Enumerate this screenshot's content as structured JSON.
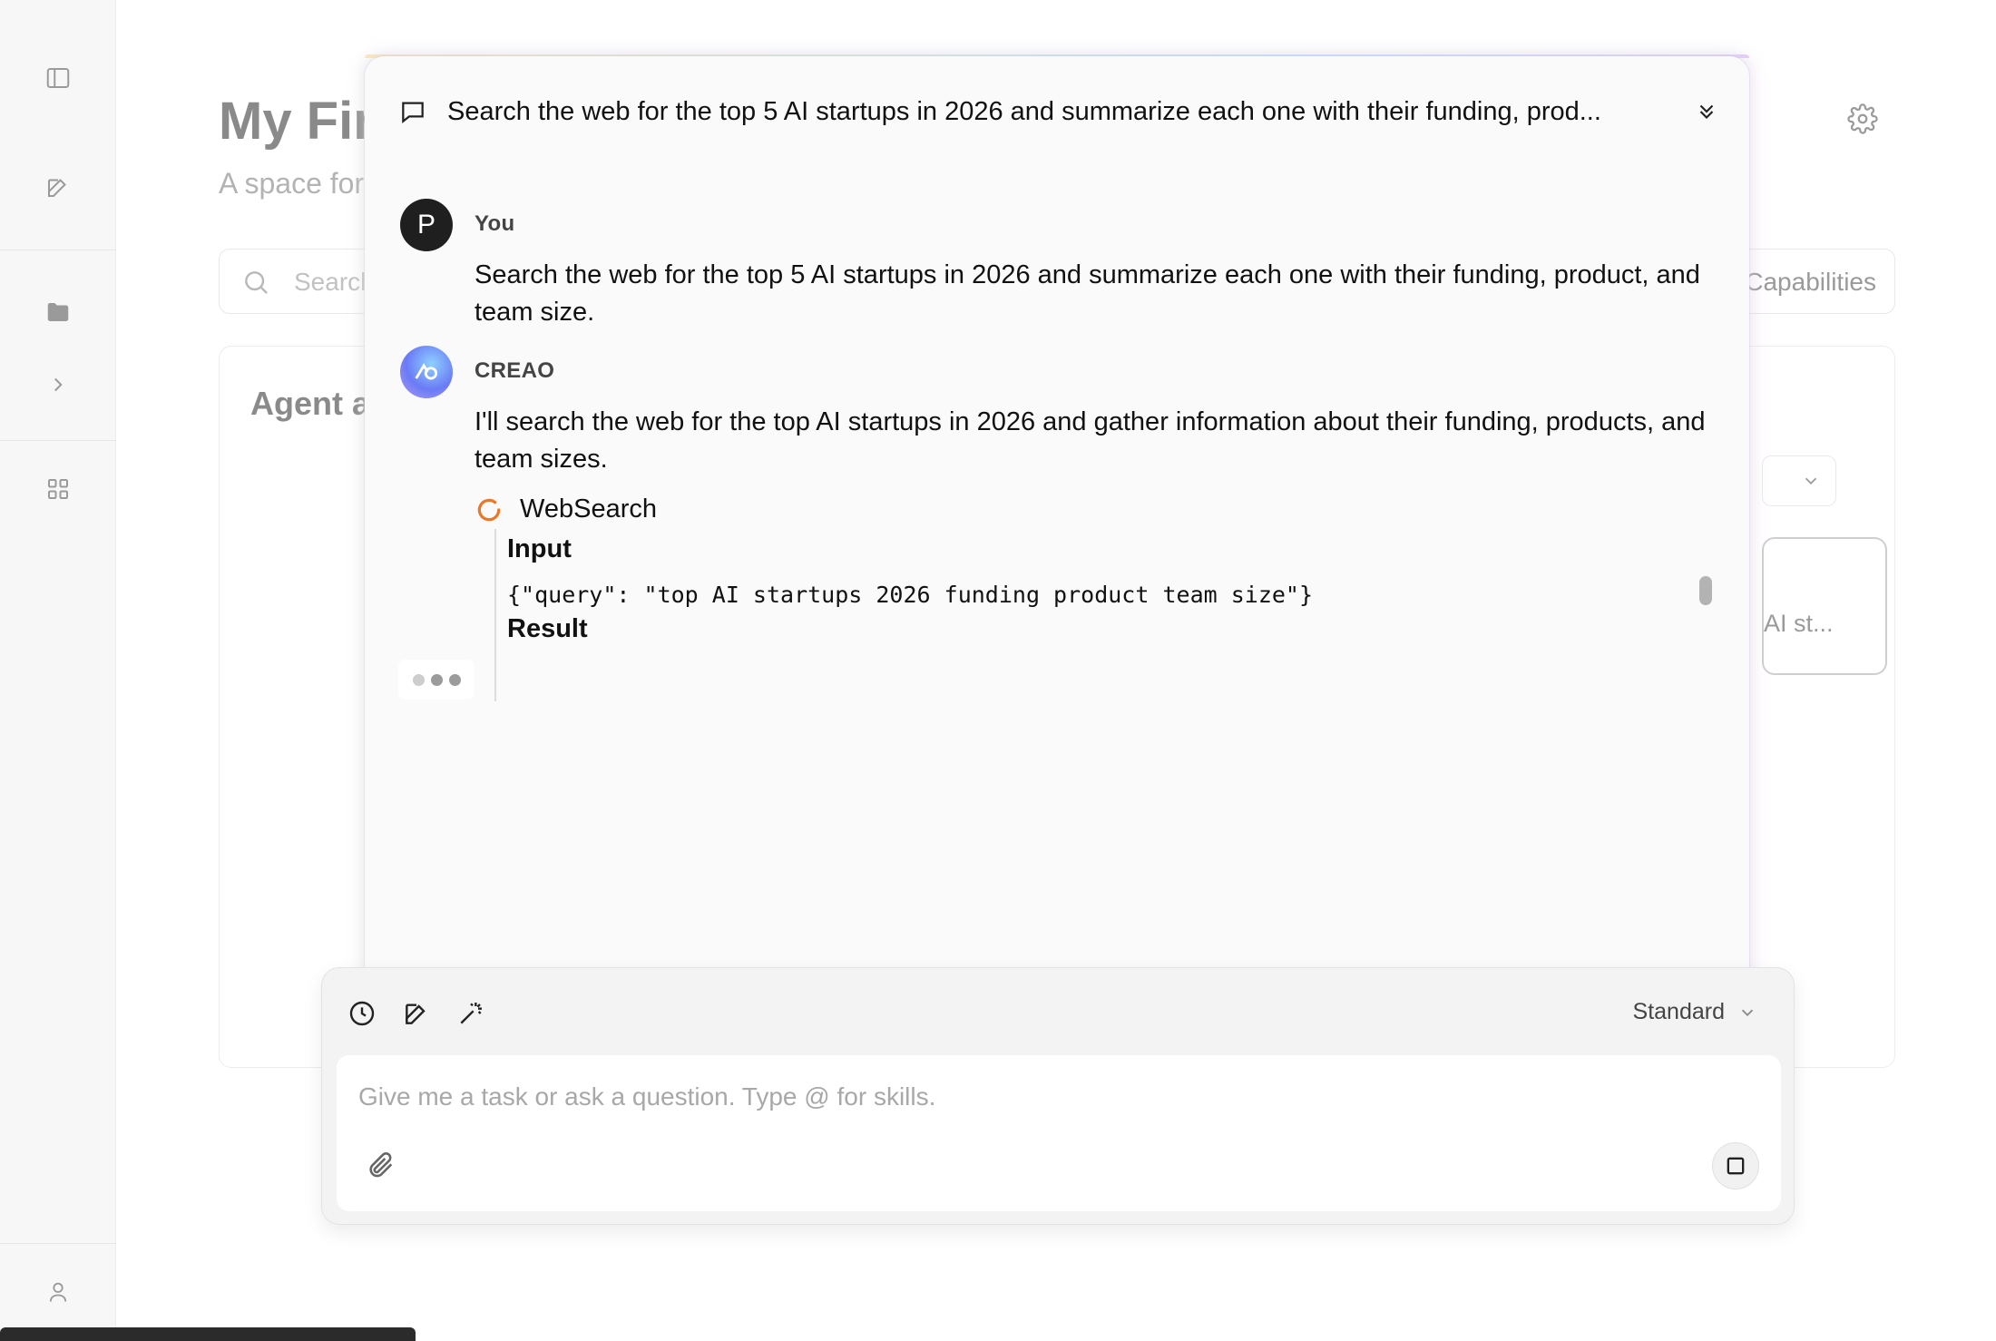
{
  "background": {
    "title": "My Fir",
    "subtitle": "A space for",
    "search_placeholder": "Search",
    "capabilities_label": "Capabilities",
    "card_title": "Agent a",
    "card_item_text": "AI st..."
  },
  "chat": {
    "header_text": "Search the web for the top 5 AI startups in 2026 and summarize each one with their funding, prod...",
    "user": {
      "avatar_letter": "P",
      "sender": "You",
      "message": "Search the web for the top 5 AI startups in 2026 and summarize each one with their funding, product, and team size."
    },
    "assistant": {
      "sender": "CREAO",
      "message": "I'll search the web for the top AI startups in 2026 and gather information about their funding, products, and team sizes."
    },
    "tool": {
      "name": "WebSearch",
      "input_label": "Input",
      "input_value": "{\"query\": \"top AI startups 2026 funding product team size\"}",
      "result_label": "Result"
    }
  },
  "composer": {
    "mode": "Standard",
    "placeholder": "Give me a task or ask a question. Type @ for skills."
  },
  "colors": {
    "spinner": "#e8782a",
    "user_avatar": "#1f1f1f",
    "panel_bg": "#fafafa"
  }
}
